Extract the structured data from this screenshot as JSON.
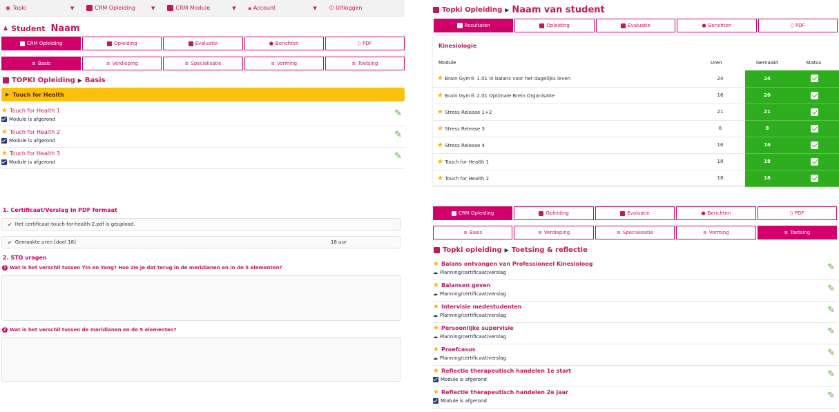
{
  "nav": {
    "items": [
      {
        "label": "Topki",
        "icon": "location-icon"
      },
      {
        "label": "CRM Opleiding",
        "icon": "book-icon"
      },
      {
        "label": "CRM Module",
        "icon": "book-icon"
      },
      {
        "label": "Account",
        "icon": "lock-icon"
      },
      {
        "label": "Uitloggen",
        "icon": "power-icon"
      }
    ]
  },
  "left": {
    "student_label": "Student",
    "student_name": "Naam",
    "main_tabs": [
      "CRM Opleiding",
      "Opleiding",
      "Evaluatie",
      "Berichten",
      "PDF"
    ],
    "sub_tabs": [
      "Basis",
      "Verdieping",
      "Specialisatie",
      "Vorming",
      "Toetsing"
    ],
    "breadcrumb_root": "TOPKI Opleiding",
    "breadcrumb_current": "Basis",
    "section_bar": "Touch for Health",
    "modules": [
      {
        "title": "Touch for Health 1",
        "status": "Module is afgerond"
      },
      {
        "title": "Touch for Health 2",
        "status": "Module is afgerond"
      },
      {
        "title": "Touch for Health 3",
        "status": "Module is afgerond"
      }
    ],
    "cert_heading": "1. Certificaat/Verslag in PDF formaat",
    "cert_msg": "Het certificaat-touch-for-health-2.pdf is geupload.",
    "hours_label": "Gemaakte uren [doel 18]",
    "hours_value": "18 uur",
    "sto_heading": "2. STO vragen",
    "questions": [
      {
        "num": "1",
        "text": "Wat is het verschil tussen Yin en Yang? Hoe zie je dat terug in de meridianen en in de 5 elementen?"
      },
      {
        "num": "2",
        "text": "Wat is het verschil tussen de meridianen en de 5 elementen?"
      }
    ]
  },
  "right_top": {
    "breadcrumb_root": "Topki Opleiding",
    "breadcrumb_current": "Naam van student",
    "tabs": [
      "Resultaten",
      "Opleiding",
      "Evaluatie",
      "Berichten",
      "PDF"
    ],
    "section_title": "Kinesiologie",
    "columns": [
      "Module",
      "Uren",
      "Gemaakt",
      "Status"
    ],
    "rows": [
      {
        "module": "Brain Gym® 1.01 In balans voor het dagelijks leven",
        "uren": "24",
        "gemaakt": "24"
      },
      {
        "module": "Brain Gym® 2.01 Optimale Brein Organisatie",
        "uren": "16",
        "gemaakt": "20"
      },
      {
        "module": "Stress Release 1+2",
        "uren": "21",
        "gemaakt": "21"
      },
      {
        "module": "Stress Release 3",
        "uren": "8",
        "gemaakt": "8"
      },
      {
        "module": "Stress Release 4",
        "uren": "16",
        "gemaakt": "16"
      },
      {
        "module": "Touch for Health 1",
        "uren": "18",
        "gemaakt": "18"
      },
      {
        "module": "Touch for Health 2",
        "uren": "18",
        "gemaakt": "18"
      }
    ]
  },
  "right_bottom": {
    "main_tabs": [
      "CRM Opleiding",
      "Opleiding",
      "Evaluatie",
      "Berichten",
      "PDF"
    ],
    "sub_tabs": [
      "Basis",
      "Verdieping",
      "Specialisatie",
      "Vorming",
      "Toetsing"
    ],
    "breadcrumb_root": "Topki opleiding",
    "breadcrumb_current": "Toetsing & reflectie",
    "items": [
      {
        "title": "Balans ontvangen van Professioneel Kinesioloog",
        "sub": "Planning/certificaat/verslag"
      },
      {
        "title": "Balansen geven",
        "sub": "Planning/certificaat/verslag"
      },
      {
        "title": "Intervisie medestudenten",
        "sub": "Planning/certificaat/verslag"
      },
      {
        "title": "Persoonlijke supervisie",
        "sub": "Planning/certificaat/verslag"
      },
      {
        "title": "Proefcasus",
        "sub": "Planning/certificaat/verslag"
      },
      {
        "title": "Reflectie therapeutisch handelen 1e start",
        "sub": "Module is afgerond"
      },
      {
        "title": "Reflectie therapeutisch handelen 2e jaar",
        "sub": "Module is afgerond"
      }
    ]
  },
  "colors": {
    "accent": "#d1006b",
    "green": "#2eae1e",
    "yellow": "#fbbf0e"
  }
}
